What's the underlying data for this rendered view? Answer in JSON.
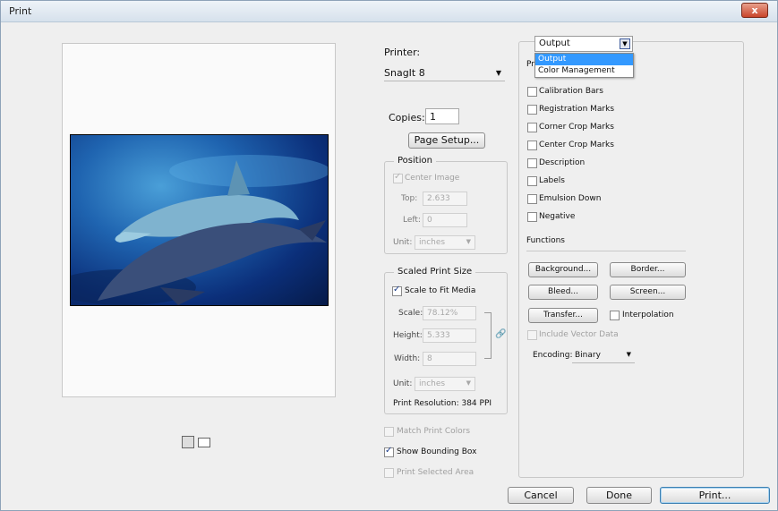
{
  "window": {
    "title": "Print",
    "close_label": "x"
  },
  "printer": {
    "label": "Printer:",
    "value": "SnagIt 8"
  },
  "copies": {
    "label": "Copies:",
    "value": "1"
  },
  "page_setup": "Page Setup...",
  "position": {
    "title": "Position",
    "center_image": {
      "label": "Center Image",
      "checked": true
    },
    "top": {
      "label": "Top:",
      "value": "2.633"
    },
    "left": {
      "label": "Left:",
      "value": "0"
    },
    "unit": {
      "label": "Unit:",
      "value": "inches"
    }
  },
  "scaled": {
    "title": "Scaled Print Size",
    "scale_to_fit": {
      "label": "Scale to Fit Media",
      "checked": true
    },
    "scale": {
      "label": "Scale:",
      "value": "78.12%"
    },
    "height": {
      "label": "Height:",
      "value": "5.333"
    },
    "width": {
      "label": "Width:",
      "value": "8"
    },
    "unit": {
      "label": "Unit:",
      "value": "inches"
    },
    "resolution": "Print Resolution: 384 PPI"
  },
  "bottom_checks": [
    {
      "label": "Match Print Colors",
      "checked": false,
      "disabled": true
    },
    {
      "label": "Show Bounding Box",
      "checked": true,
      "disabled": false
    },
    {
      "label": "Print Selected Area",
      "checked": false,
      "disabled": true
    }
  ],
  "output_dropdown": {
    "value": "Output",
    "options": [
      "Output",
      "Color Management"
    ],
    "selected": "Output"
  },
  "section_prefix": "Pr",
  "output_checks": [
    "Calibration Bars",
    "Registration Marks",
    "Corner Crop Marks",
    "Center Crop Marks",
    "Description",
    "Labels",
    "Emulsion Down",
    "Negative"
  ],
  "functions": {
    "label": "Functions",
    "background": "Background...",
    "border": "Border...",
    "bleed": "Bleed...",
    "screen": "Screen...",
    "transfer": "Transfer...",
    "interpolation": "Interpolation",
    "include_vector": "Include Vector Data",
    "encoding_label": "Encoding:",
    "encoding_value": "Binary"
  },
  "buttons": {
    "cancel": "Cancel",
    "done": "Done",
    "print": "Print..."
  }
}
